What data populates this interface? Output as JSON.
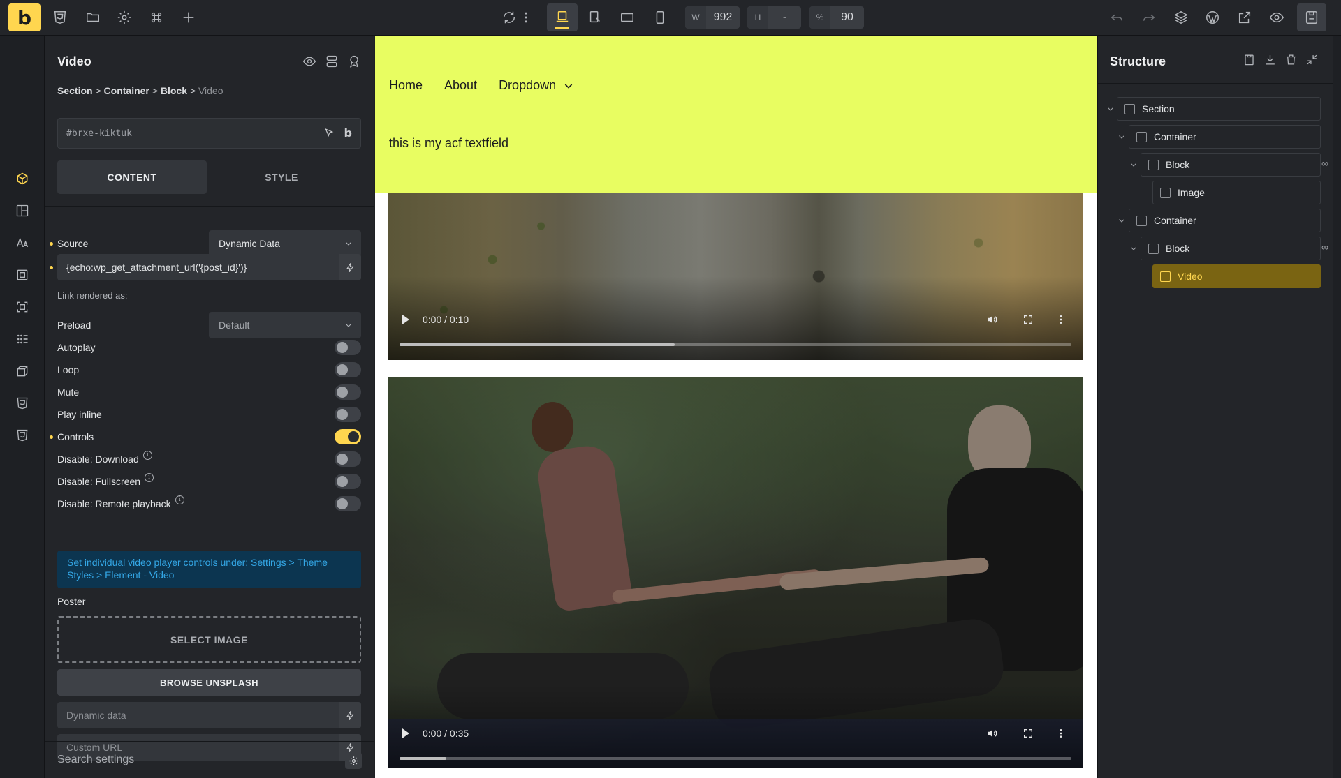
{
  "toolbar": {
    "logo": "b",
    "width_key": "W",
    "width_value": "992",
    "height_key": "H",
    "height_value": "-",
    "zoom_key": "%",
    "zoom_value": "90",
    "accent": "#ffd64f"
  },
  "panel": {
    "title": "Video",
    "breadcrumb": [
      "Section",
      "Container",
      "Block",
      "Video"
    ],
    "breadcrumb_sep": ">",
    "element_id": "#brxe-kiktuk",
    "element_id_badge": "b",
    "tabs": [
      "CONTENT",
      "STYLE"
    ],
    "source": {
      "label": "Source",
      "value": "Dynamic Data"
    },
    "dynamic_value": "{echo:wp_get_attachment_url('{post_id}')}",
    "link_rendered_as": "Link rendered as:",
    "preload": {
      "label": "Preload",
      "value": "Default"
    },
    "toggles": [
      {
        "label": "Autoplay",
        "on": false
      },
      {
        "label": "Loop",
        "on": false
      },
      {
        "label": "Mute",
        "on": false
      },
      {
        "label": "Play inline",
        "on": false
      },
      {
        "label": "Controls",
        "on": true
      },
      {
        "label": "Disable: Download",
        "on": false
      },
      {
        "label": "Disable: Fullscreen",
        "on": false
      },
      {
        "label": "Disable: Remote playback",
        "on": false
      }
    ],
    "note": "Set individual video player controls under: Settings > Theme Styles > Element - Video",
    "poster_label": "Poster",
    "select_image": "SELECT IMAGE",
    "browse_unsplash": "BROWSE UNSPLASH",
    "dynamic_data_placeholder": "Dynamic data",
    "custom_url_placeholder": "Custom URL",
    "search_placeholder": "Search settings"
  },
  "canvas": {
    "nav": [
      "Home",
      "About",
      "Dropdown"
    ],
    "acf_text": "this is my acf textfield",
    "header_color": "#e8fd61",
    "videos": [
      {
        "time": "0:00 / 0:10",
        "progress": 0.41
      },
      {
        "time": "0:00 / 0:35",
        "progress": 0.07
      }
    ]
  },
  "structure": {
    "title": "Structure",
    "nodes": [
      "Section",
      "Container",
      "Block",
      "Image",
      "Container",
      "Block",
      "Video"
    ]
  }
}
